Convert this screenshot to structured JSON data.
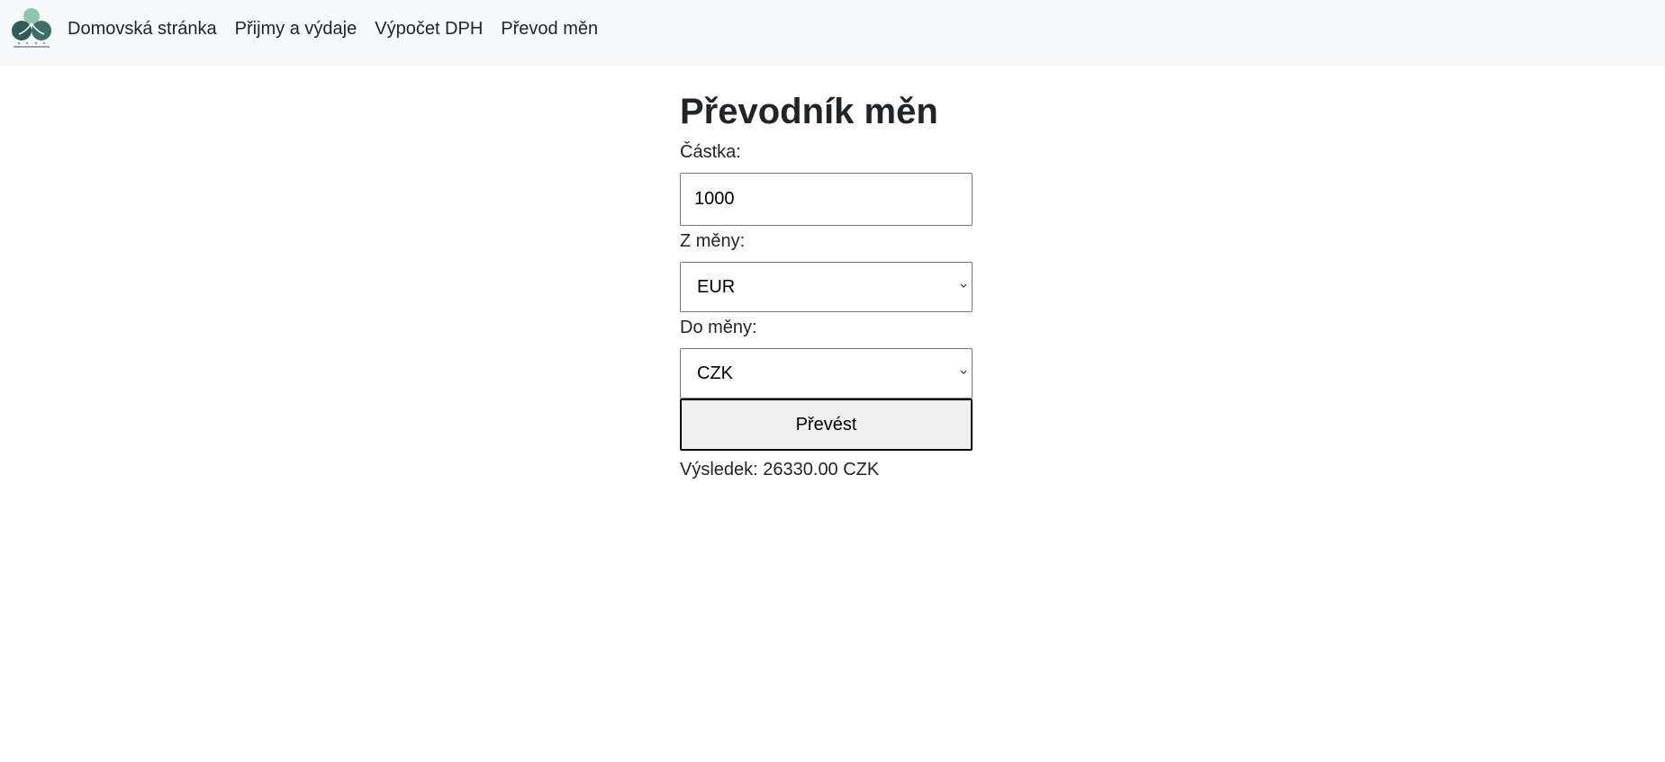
{
  "nav": {
    "logo_icon": "plant-leaves-logo",
    "links": [
      {
        "label": "Domovská stránka"
      },
      {
        "label": "Přijmy a výdaje"
      },
      {
        "label": "Výpočet DPH"
      },
      {
        "label": "Převod měn"
      }
    ]
  },
  "converter": {
    "title": "Převodník měn",
    "amount_label": "Částka:",
    "amount_value": "1000",
    "from_label": "Z měny:",
    "from_value": "EUR",
    "to_label": "Do měny:",
    "to_value": "CZK",
    "button_label": "Převést",
    "result_text": "Výsledek: 26330.00 CZK"
  },
  "colors": {
    "navbar_bg": "#f8f9fa",
    "text": "#212529",
    "button_bg": "#efefef",
    "logo_dark": "#2f5c5a",
    "logo_light": "#8fc7ae"
  }
}
